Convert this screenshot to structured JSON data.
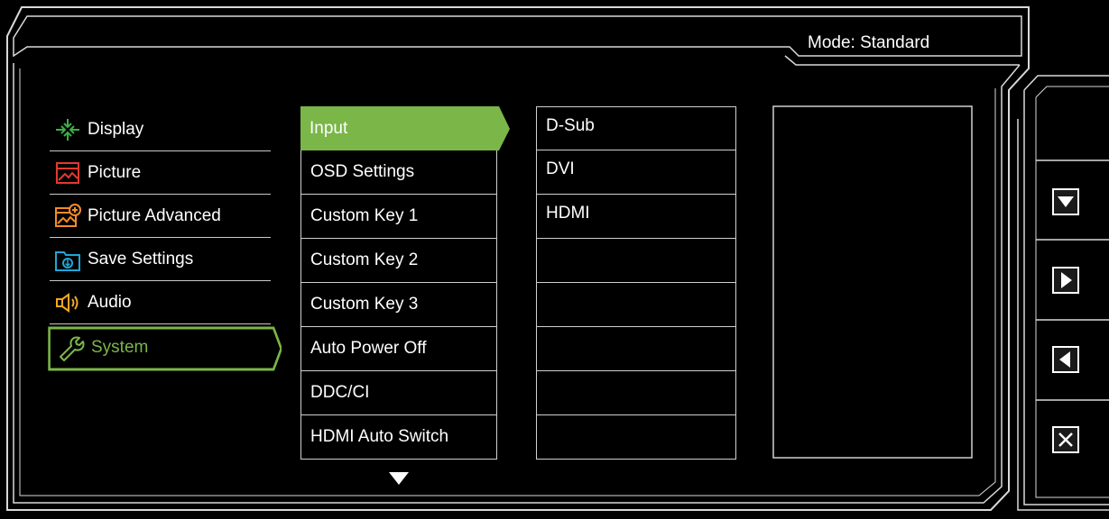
{
  "header": {
    "mode_label": "Mode:",
    "mode_value": "Standard"
  },
  "main_menu": {
    "items": [
      {
        "label": "Display",
        "icon": "display-icon"
      },
      {
        "label": "Picture",
        "icon": "picture-icon"
      },
      {
        "label": "Picture Advanced",
        "icon": "picture-advanced-icon"
      },
      {
        "label": "Save Settings",
        "icon": "save-settings-icon"
      },
      {
        "label": "Audio",
        "icon": "audio-icon"
      },
      {
        "label": "System",
        "icon": "system-wrench-icon",
        "selected": true
      }
    ]
  },
  "sub_menu": {
    "items": [
      {
        "label": "Input",
        "selected": true
      },
      {
        "label": "OSD Settings"
      },
      {
        "label": "Custom Key 1"
      },
      {
        "label": "Custom Key 2"
      },
      {
        "label": "Custom Key 3"
      },
      {
        "label": "Auto Power Off"
      },
      {
        "label": "DDC/CI"
      },
      {
        "label": "HDMI Auto Switch"
      }
    ],
    "more_indicator": "down-arrow-icon"
  },
  "options": {
    "items": [
      "D-Sub",
      "DVI",
      "HDMI",
      "",
      "",
      "",
      "",
      ""
    ]
  },
  "side_keys": [
    {
      "icon": "down-arrow-icon"
    },
    {
      "icon": "right-arrow-icon"
    },
    {
      "icon": "left-arrow-icon"
    },
    {
      "icon": "close-icon"
    }
  ],
  "colors": {
    "background": "#000000",
    "accent_green": "#7ab648",
    "frame": "#d9d9d9",
    "display_icon": "#3fae49",
    "picture_icon": "#e03a2f",
    "picture_advanced_icon": "#f28c28",
    "save_icon": "#1ea7d8",
    "audio_icon": "#f5a623"
  }
}
